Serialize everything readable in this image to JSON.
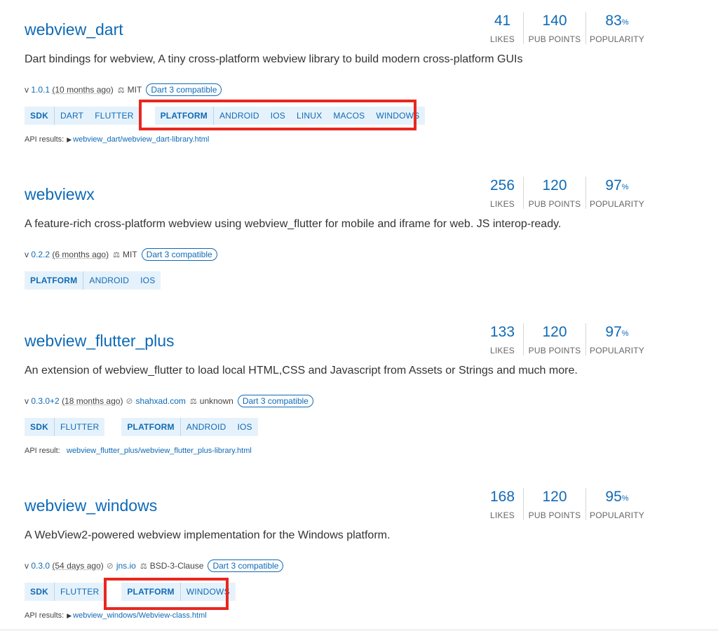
{
  "packages": [
    {
      "title": "webview_dart",
      "likes": "41",
      "pub_points": "140",
      "popularity": "83",
      "labels": {
        "likes": "LIKES",
        "pub_points": "PUB POINTS",
        "popularity": "POPULARITY",
        "percent": "%"
      },
      "description": "Dart bindings for webview, A tiny cross-platform webview library to build modern cross-platform GUIs",
      "version_prefix": "v",
      "version": "1.0.1",
      "ago": "(10 months ago)",
      "license": "MIT",
      "compat": "Dart 3 compatible",
      "sdk_tags": [
        "SDK",
        "DART",
        "FLUTTER"
      ],
      "platform_tags": [
        "PLATFORM",
        "ANDROID",
        "IOS",
        "LINUX",
        "MACOS",
        "WINDOWS"
      ],
      "api_label": "API results:",
      "api_link": "webview_dart/webview_dart-library.html"
    },
    {
      "title": "webviewx",
      "likes": "256",
      "pub_points": "120",
      "popularity": "97",
      "description": "A feature-rich cross-platform webview using webview_flutter for mobile and iframe for web. JS interop-ready.",
      "version_prefix": "v",
      "version": "0.2.2",
      "ago": "(6 months ago)",
      "license": "MIT",
      "compat": "Dart 3 compatible",
      "platform_tags": [
        "PLATFORM",
        "ANDROID",
        "IOS"
      ]
    },
    {
      "title": "webview_flutter_plus",
      "likes": "133",
      "pub_points": "120",
      "popularity": "97",
      "description": "An extension of webview_flutter to load local HTML,CSS and Javascript from Assets or Strings and much more.",
      "version_prefix": "v",
      "version": "0.3.0+2",
      "ago": "(18 months ago)",
      "publisher": "shahxad.com",
      "license": "unknown",
      "compat": "Dart 3 compatible",
      "sdk_tags": [
        "SDK",
        "FLUTTER"
      ],
      "platform_tags": [
        "PLATFORM",
        "ANDROID",
        "IOS"
      ],
      "api_label": "API result:",
      "api_link": "webview_flutter_plus/webview_flutter_plus-library.html"
    },
    {
      "title": "webview_windows",
      "likes": "168",
      "pub_points": "120",
      "popularity": "95",
      "description": "A WebView2-powered webview implementation for the Windows platform.",
      "version_prefix": "v",
      "version": "0.3.0",
      "ago": "(54 days ago)",
      "publisher": "jns.io",
      "license": "BSD-3-Clause",
      "compat": "Dart 3 compatible",
      "sdk_tags": [
        "SDK",
        "FLUTTER"
      ],
      "platform_tags": [
        "PLATFORM",
        "WINDOWS"
      ],
      "api_label": "API results:",
      "api_link": "webview_windows/Webview-class.html"
    }
  ],
  "colors": {
    "accent": "#0f6ab6",
    "tag_bg": "#e6f2fb",
    "highlight": "#e8271f"
  },
  "icons": {
    "license": "balance-scale-icon",
    "publisher": "verified-publisher-icon",
    "api_expand": "triangle-right-icon"
  }
}
